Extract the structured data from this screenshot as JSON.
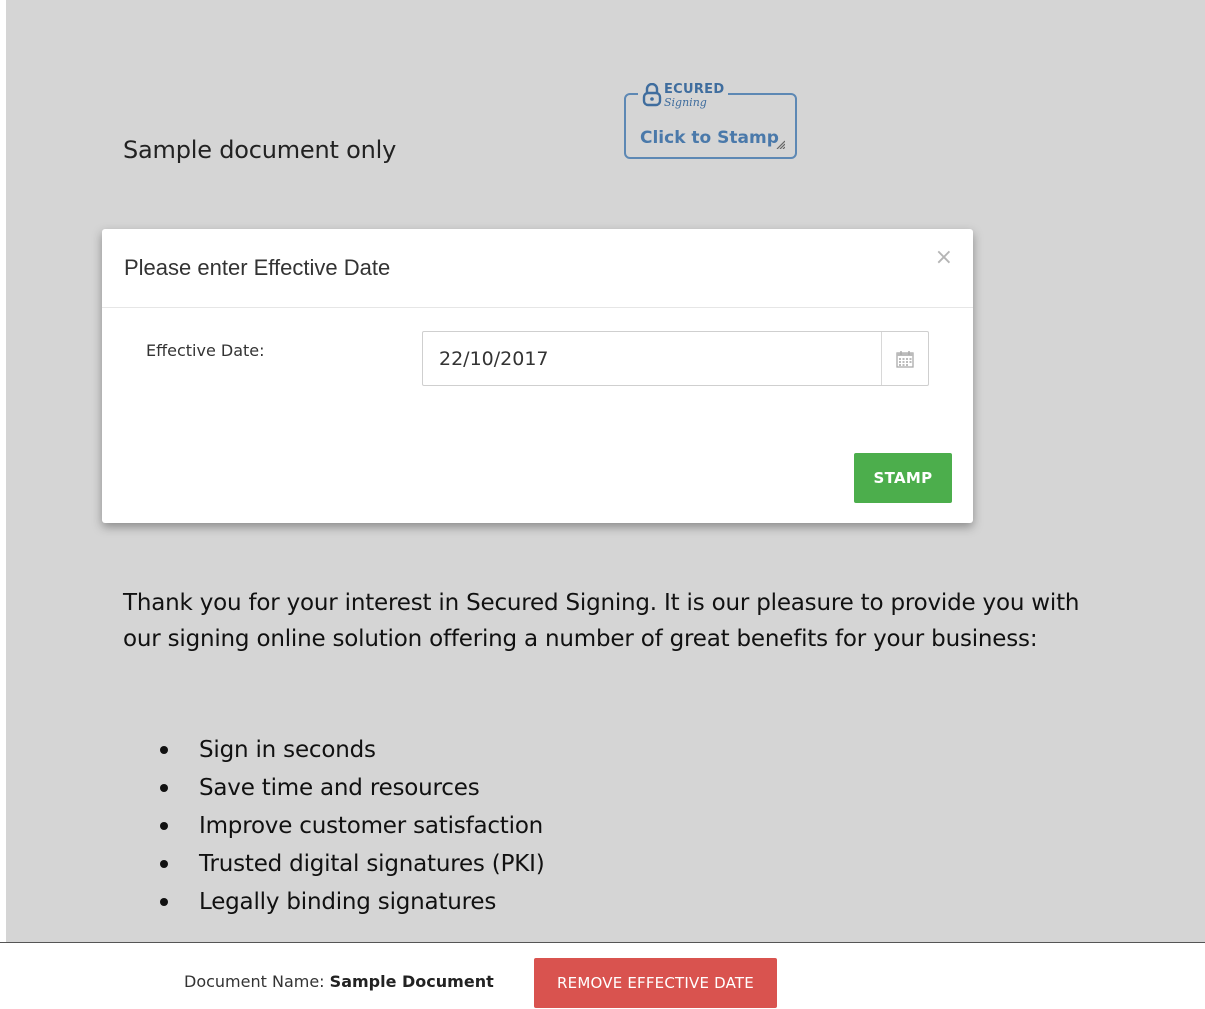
{
  "document": {
    "heading": "Sample document only",
    "intro": "Thank you for your interest in Secured Signing. It is our pleasure to provide you with our signing online solution offering a number of great benefits for your business:",
    "benefits": [
      "Sign in seconds",
      "Save time and resources",
      "Improve customer satisfaction",
      "Trusted digital signatures (PKI)",
      "Legally binding signatures"
    ]
  },
  "stamp": {
    "logo_title": "ECURED",
    "logo_subtitle": "Signing",
    "label": "Click to Stamp",
    "icons": [
      "padlock-icon",
      "resize-handle-icon"
    ]
  },
  "modal": {
    "title": "Please enter Effective Date",
    "close_symbol": "×",
    "field_label": "Effective Date:",
    "date_value": "22/10/2017",
    "calendar_icon": "calendar-icon",
    "stamp_button": "STAMP"
  },
  "footer": {
    "doc_name_label": "Document Name:",
    "doc_name_value": "Sample Document",
    "remove_button": "REMOVE EFFECTIVE DATE"
  },
  "colors": {
    "background": "#d5d5d5",
    "stamp_blue": "#5d88b4",
    "success_green": "#4cae4c",
    "danger_red": "#d9534f"
  }
}
